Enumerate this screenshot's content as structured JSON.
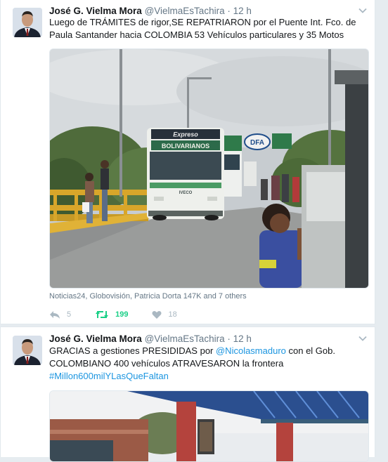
{
  "tweets": [
    {
      "author": "José G. Vielma Mora",
      "handle": "@VielmaEsTachira",
      "separator": "·",
      "time": "12 h",
      "text": "Luego de TRÁMITES de rigor,SE REPATRIARON por el Puente Int. Fco. de Paula Santander hacia COLOMBIA 53 Vehículos particulares y 35 Motos",
      "media": {
        "bus_sign_top": "Expreso",
        "bus_sign_main": "BOLIVARIANOS",
        "bus_brand": "IVECO",
        "road_sign": "DFA"
      },
      "attribution": "Noticias24, Globovisión, Patricia Dorta 147K and 7 others",
      "replies": "5",
      "retweets": "199",
      "likes": "18"
    },
    {
      "author": "José G. Vielma Mora",
      "handle": "@VielmaEsTachira",
      "separator": "·",
      "time": "12 h",
      "text_before_mention": "GRACIAS a gestiones PRESIDIDAS por ",
      "mention": "@Nicolasmaduro",
      "text_after_mention": " con el Gob. COLOMBIANO 400 vehículos ATRAVESARON la frontera",
      "hashtag": "#Millon600milYLasQueFaltan"
    }
  ],
  "colors": {
    "link": "#1b95e0",
    "retweet_active": "#19cf86",
    "muted": "#657786",
    "background": "#e6ecf0"
  },
  "icons": [
    "chevron-down-icon",
    "reply-icon",
    "retweet-icon",
    "heart-icon"
  ]
}
